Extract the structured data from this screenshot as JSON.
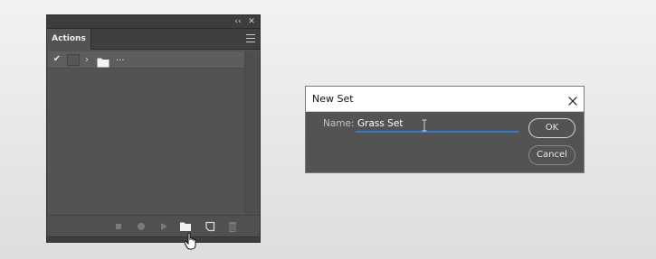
{
  "actions_panel": {
    "tab_label": "Actions",
    "topbar": {
      "collapse_glyph": "‹‹",
      "close_glyph": "✕"
    },
    "row": {
      "check_glyph": "✔",
      "chevron_glyph": "›",
      "label": "..."
    },
    "icons": [
      "stop-recording-icon",
      "record-icon",
      "play-icon",
      "new-set-folder-icon",
      "new-action-icon",
      "trash-icon"
    ]
  },
  "new_set_dialog": {
    "title": "New Set",
    "name_label": "Name:",
    "name_value": "Grass Set",
    "ok_label": "OK",
    "cancel_label": "Cancel",
    "focus_color": "#2f7ad1"
  }
}
